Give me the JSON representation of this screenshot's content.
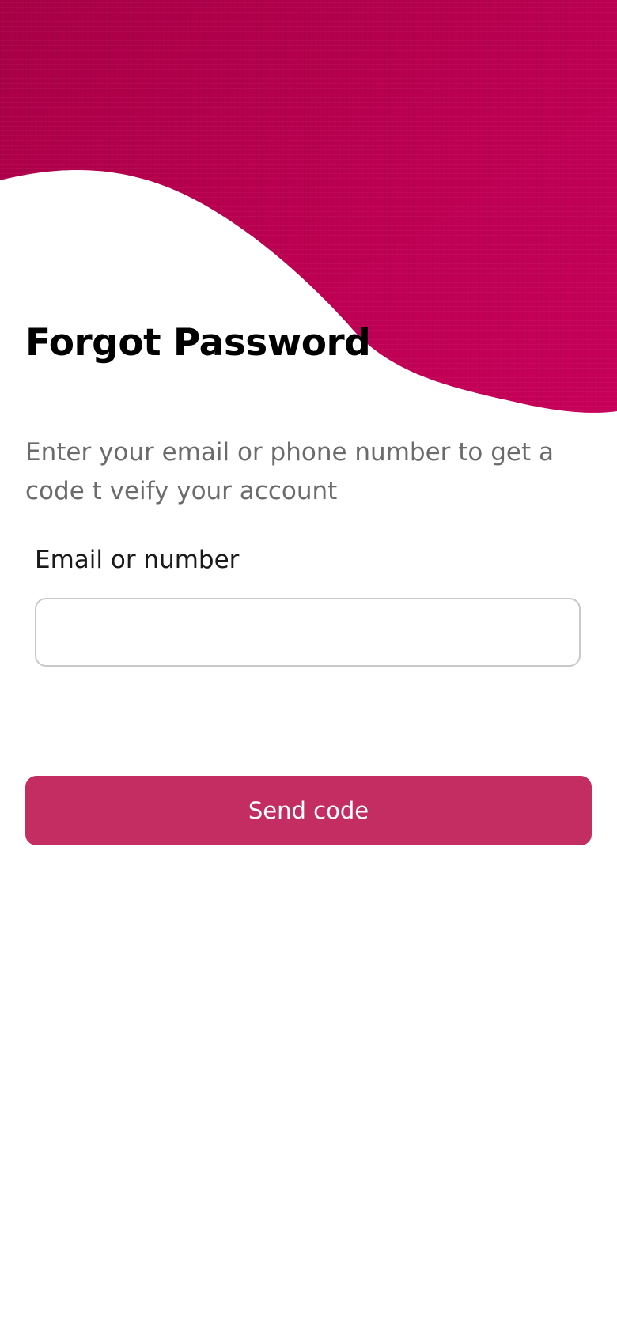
{
  "header": {
    "title": "Forgot Password"
  },
  "form": {
    "instructions": "Enter your email or phone number to get a code t veify your account",
    "field_label": "Email or number",
    "field_value": "",
    "field_placeholder": "",
    "submit_label": "Send code"
  },
  "colors": {
    "brand_banner": "#b8004f",
    "button": "#c42d61",
    "input_border": "#c9c9c9",
    "muted_text": "#6b6b6b"
  }
}
